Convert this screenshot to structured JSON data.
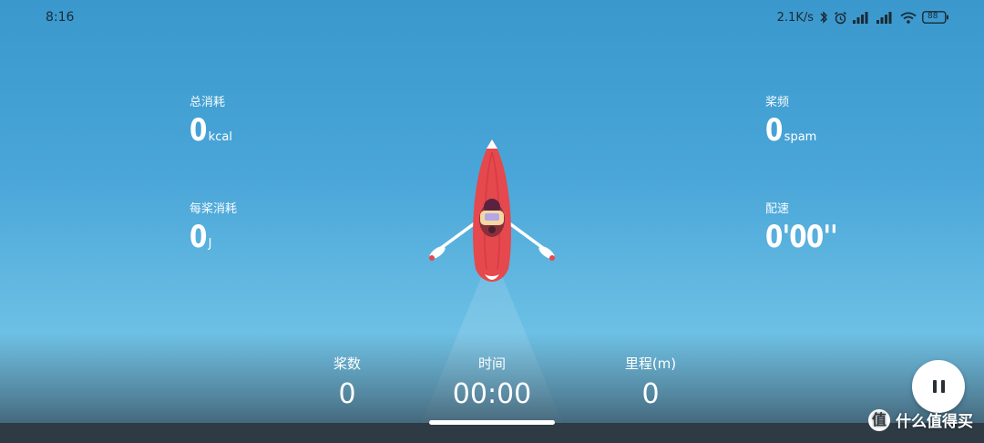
{
  "status_bar": {
    "time": "8:16",
    "network_speed": "2.1K/s",
    "icons": [
      "bluetooth-icon",
      "alarm-icon",
      "signal-icon",
      "signal-icon",
      "wifi-icon",
      "battery-icon"
    ],
    "battery_level": "88"
  },
  "metrics": {
    "total_calories": {
      "label": "总消耗",
      "value": "0",
      "unit": "kcal"
    },
    "per_stroke_energy": {
      "label": "每桨消耗",
      "value": "0",
      "unit": "J"
    },
    "stroke_rate": {
      "label": "桨频",
      "value": "0",
      "unit": "spam"
    },
    "pace": {
      "label": "配速",
      "value": "0'00''",
      "unit": ""
    }
  },
  "bottom": {
    "strokes": {
      "label": "桨数",
      "value": "0"
    },
    "time": {
      "label": "时间",
      "value": "00:00"
    },
    "distance": {
      "label": "里程(m)",
      "value": "0"
    }
  },
  "controls": {
    "pause_icon": "pause-icon"
  },
  "watermark": {
    "logo": "值",
    "text": "什么值得买"
  },
  "colors": {
    "sky_top": "#3a98cd",
    "sky_bottom": "#7ccbe9",
    "boat_red": "#e5484d",
    "paddle_tip": "#e5484d",
    "nav_bar": "#2e3a44"
  }
}
